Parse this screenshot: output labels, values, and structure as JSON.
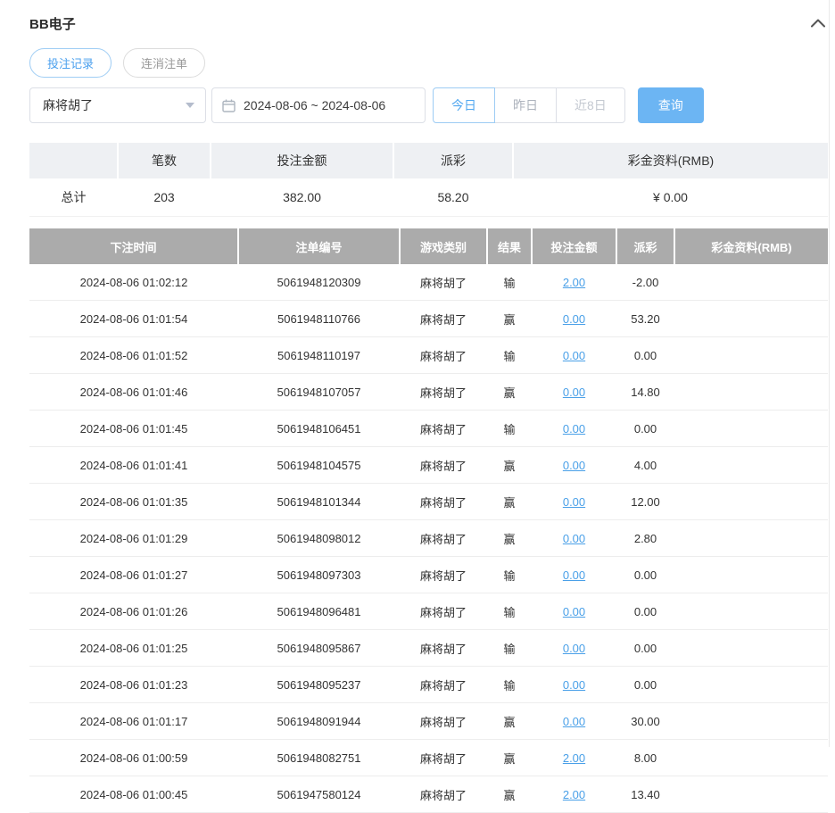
{
  "header": {
    "title": "BB电子"
  },
  "tabs": [
    {
      "label": "投注记录",
      "active": true
    },
    {
      "label": "连消注单",
      "active": false
    }
  ],
  "filters": {
    "game_selected": "麻将胡了",
    "date_range": "2024-08-06 ~ 2024-08-06",
    "quick_ranges": [
      {
        "label": "今日",
        "active": true
      },
      {
        "label": "昨日",
        "active": false
      },
      {
        "label": "近8日",
        "active": false
      }
    ],
    "search_label": "查询"
  },
  "summary": {
    "headers": [
      "",
      "笔数",
      "投注金额",
      "派彩",
      "彩金资料(RMB)"
    ],
    "total_label": "总计",
    "count": "203",
    "bet_amount": "382.00",
    "payout": "58.20",
    "bonus": "¥ 0.00"
  },
  "table": {
    "headers": [
      "下注时间",
      "注单编号",
      "游戏类别",
      "结果",
      "投注金额",
      "派彩",
      "彩金资料(RMB)"
    ],
    "rows": [
      {
        "time": "2024-08-06 01:02:12",
        "order": "5061948120309",
        "game": "麻将胡了",
        "result": "输",
        "amount": "2.00",
        "payout": "-2.00",
        "bonus": ""
      },
      {
        "time": "2024-08-06 01:01:54",
        "order": "5061948110766",
        "game": "麻将胡了",
        "result": "赢",
        "amount": "0.00",
        "payout": "53.20",
        "bonus": ""
      },
      {
        "time": "2024-08-06 01:01:52",
        "order": "5061948110197",
        "game": "麻将胡了",
        "result": "输",
        "amount": "0.00",
        "payout": "0.00",
        "bonus": ""
      },
      {
        "time": "2024-08-06 01:01:46",
        "order": "5061948107057",
        "game": "麻将胡了",
        "result": "赢",
        "amount": "0.00",
        "payout": "14.80",
        "bonus": ""
      },
      {
        "time": "2024-08-06 01:01:45",
        "order": "5061948106451",
        "game": "麻将胡了",
        "result": "输",
        "amount": "0.00",
        "payout": "0.00",
        "bonus": ""
      },
      {
        "time": "2024-08-06 01:01:41",
        "order": "5061948104575",
        "game": "麻将胡了",
        "result": "赢",
        "amount": "0.00",
        "payout": "4.00",
        "bonus": ""
      },
      {
        "time": "2024-08-06 01:01:35",
        "order": "5061948101344",
        "game": "麻将胡了",
        "result": "赢",
        "amount": "0.00",
        "payout": "12.00",
        "bonus": ""
      },
      {
        "time": "2024-08-06 01:01:29",
        "order": "5061948098012",
        "game": "麻将胡了",
        "result": "赢",
        "amount": "0.00",
        "payout": "2.80",
        "bonus": ""
      },
      {
        "time": "2024-08-06 01:01:27",
        "order": "5061948097303",
        "game": "麻将胡了",
        "result": "输",
        "amount": "0.00",
        "payout": "0.00",
        "bonus": ""
      },
      {
        "time": "2024-08-06 01:01:26",
        "order": "5061948096481",
        "game": "麻将胡了",
        "result": "输",
        "amount": "0.00",
        "payout": "0.00",
        "bonus": ""
      },
      {
        "time": "2024-08-06 01:01:25",
        "order": "5061948095867",
        "game": "麻将胡了",
        "result": "输",
        "amount": "0.00",
        "payout": "0.00",
        "bonus": ""
      },
      {
        "time": "2024-08-06 01:01:23",
        "order": "5061948095237",
        "game": "麻将胡了",
        "result": "输",
        "amount": "0.00",
        "payout": "0.00",
        "bonus": ""
      },
      {
        "time": "2024-08-06 01:01:17",
        "order": "5061948091944",
        "game": "麻将胡了",
        "result": "赢",
        "amount": "0.00",
        "payout": "30.00",
        "bonus": ""
      },
      {
        "time": "2024-08-06 01:00:59",
        "order": "5061948082751",
        "game": "麻将胡了",
        "result": "赢",
        "amount": "2.00",
        "payout": "8.00",
        "bonus": ""
      },
      {
        "time": "2024-08-06 01:00:45",
        "order": "5061947580124",
        "game": "麻将胡了",
        "result": "赢",
        "amount": "2.00",
        "payout": "13.40",
        "bonus": ""
      }
    ]
  },
  "icons": {
    "collapse_icon": "chevron-up",
    "calendar_icon": "calendar",
    "select_caret_icon": "chevron-down"
  },
  "colors": {
    "accent_blue": "#6cb5f3",
    "link_blue": "#4aa0e8",
    "negative_red": "#e25a5a",
    "table_header_bg": "#ababab",
    "summary_header_bg": "#eef0f3"
  }
}
